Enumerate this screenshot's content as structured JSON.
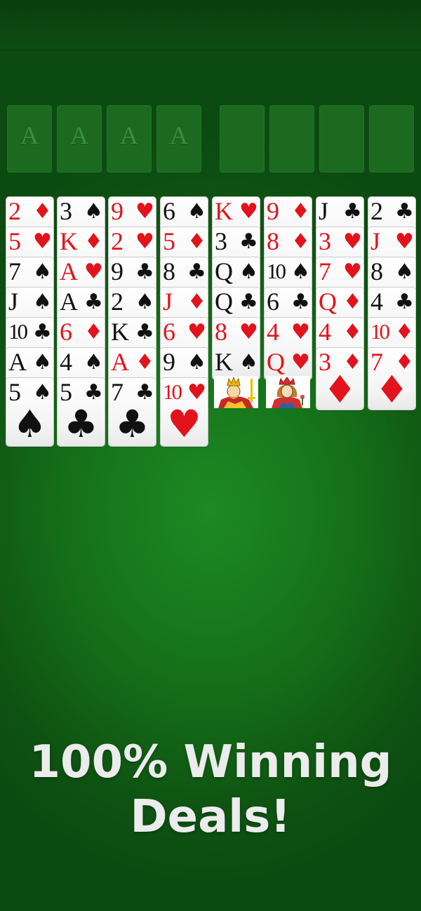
{
  "colors": {
    "felt": "#157019",
    "red": "#e2131c",
    "black": "#111111",
    "promo_text": "#ececec"
  },
  "foundations": [
    {
      "label": "A"
    },
    {
      "label": "A"
    },
    {
      "label": "A"
    },
    {
      "label": "A"
    }
  ],
  "free_cells": [
    {},
    {},
    {},
    {}
  ],
  "tableau": [
    [
      {
        "rank": "2",
        "suit": "♦",
        "color": "red"
      },
      {
        "rank": "5",
        "suit": "♥",
        "color": "red"
      },
      {
        "rank": "7",
        "suit": "♠",
        "color": "black"
      },
      {
        "rank": "J",
        "suit": "♠",
        "color": "black"
      },
      {
        "rank": "10",
        "suit": "♣",
        "color": "black"
      },
      {
        "rank": "A",
        "suit": "♠",
        "color": "black"
      },
      {
        "rank": "5",
        "suit": "♠",
        "color": "black"
      }
    ],
    [
      {
        "rank": "3",
        "suit": "♠",
        "color": "black"
      },
      {
        "rank": "K",
        "suit": "♦",
        "color": "red"
      },
      {
        "rank": "A",
        "suit": "♥",
        "color": "red"
      },
      {
        "rank": "A",
        "suit": "♣",
        "color": "black"
      },
      {
        "rank": "6",
        "suit": "♦",
        "color": "red"
      },
      {
        "rank": "4",
        "suit": "♠",
        "color": "black"
      },
      {
        "rank": "5",
        "suit": "♣",
        "color": "black"
      }
    ],
    [
      {
        "rank": "9",
        "suit": "♥",
        "color": "red"
      },
      {
        "rank": "2",
        "suit": "♥",
        "color": "red"
      },
      {
        "rank": "9",
        "suit": "♣",
        "color": "black"
      },
      {
        "rank": "2",
        "suit": "♠",
        "color": "black"
      },
      {
        "rank": "K",
        "suit": "♣",
        "color": "black"
      },
      {
        "rank": "A",
        "suit": "♦",
        "color": "red"
      },
      {
        "rank": "7",
        "suit": "♣",
        "color": "black"
      }
    ],
    [
      {
        "rank": "6",
        "suit": "♠",
        "color": "black"
      },
      {
        "rank": "5",
        "suit": "♦",
        "color": "red"
      },
      {
        "rank": "8",
        "suit": "♣",
        "color": "black"
      },
      {
        "rank": "J",
        "suit": "♦",
        "color": "red"
      },
      {
        "rank": "6",
        "suit": "♥",
        "color": "red"
      },
      {
        "rank": "9",
        "suit": "♠",
        "color": "black"
      },
      {
        "rank": "10",
        "suit": "♥",
        "color": "red"
      }
    ],
    [
      {
        "rank": "K",
        "suit": "♥",
        "color": "red"
      },
      {
        "rank": "3",
        "suit": "♣",
        "color": "black"
      },
      {
        "rank": "Q",
        "suit": "♠",
        "color": "black"
      },
      {
        "rank": "Q",
        "suit": "♣",
        "color": "black"
      },
      {
        "rank": "8",
        "suit": "♥",
        "color": "red"
      },
      {
        "rank": "K",
        "suit": "♠",
        "color": "black",
        "face": "king"
      }
    ],
    [
      {
        "rank": "9",
        "suit": "♦",
        "color": "red"
      },
      {
        "rank": "8",
        "suit": "♦",
        "color": "red"
      },
      {
        "rank": "10",
        "suit": "♠",
        "color": "black"
      },
      {
        "rank": "6",
        "suit": "♣",
        "color": "black"
      },
      {
        "rank": "4",
        "suit": "♥",
        "color": "red"
      },
      {
        "rank": "Q",
        "suit": "♥",
        "color": "red",
        "face": "queen"
      }
    ],
    [
      {
        "rank": "J",
        "suit": "♣",
        "color": "black"
      },
      {
        "rank": "3",
        "suit": "♥",
        "color": "red"
      },
      {
        "rank": "7",
        "suit": "♥",
        "color": "red"
      },
      {
        "rank": "Q",
        "suit": "♦",
        "color": "red"
      },
      {
        "rank": "4",
        "suit": "♦",
        "color": "red"
      },
      {
        "rank": "3",
        "suit": "♦",
        "color": "red"
      }
    ],
    [
      {
        "rank": "2",
        "suit": "♣",
        "color": "black"
      },
      {
        "rank": "J",
        "suit": "♥",
        "color": "red"
      },
      {
        "rank": "8",
        "suit": "♠",
        "color": "black"
      },
      {
        "rank": "4",
        "suit": "♣",
        "color": "black"
      },
      {
        "rank": "10",
        "suit": "♦",
        "color": "red"
      },
      {
        "rank": "7",
        "suit": "♦",
        "color": "red"
      }
    ]
  ],
  "promo": {
    "line1": "100% Winning",
    "line2": "Deals!"
  }
}
